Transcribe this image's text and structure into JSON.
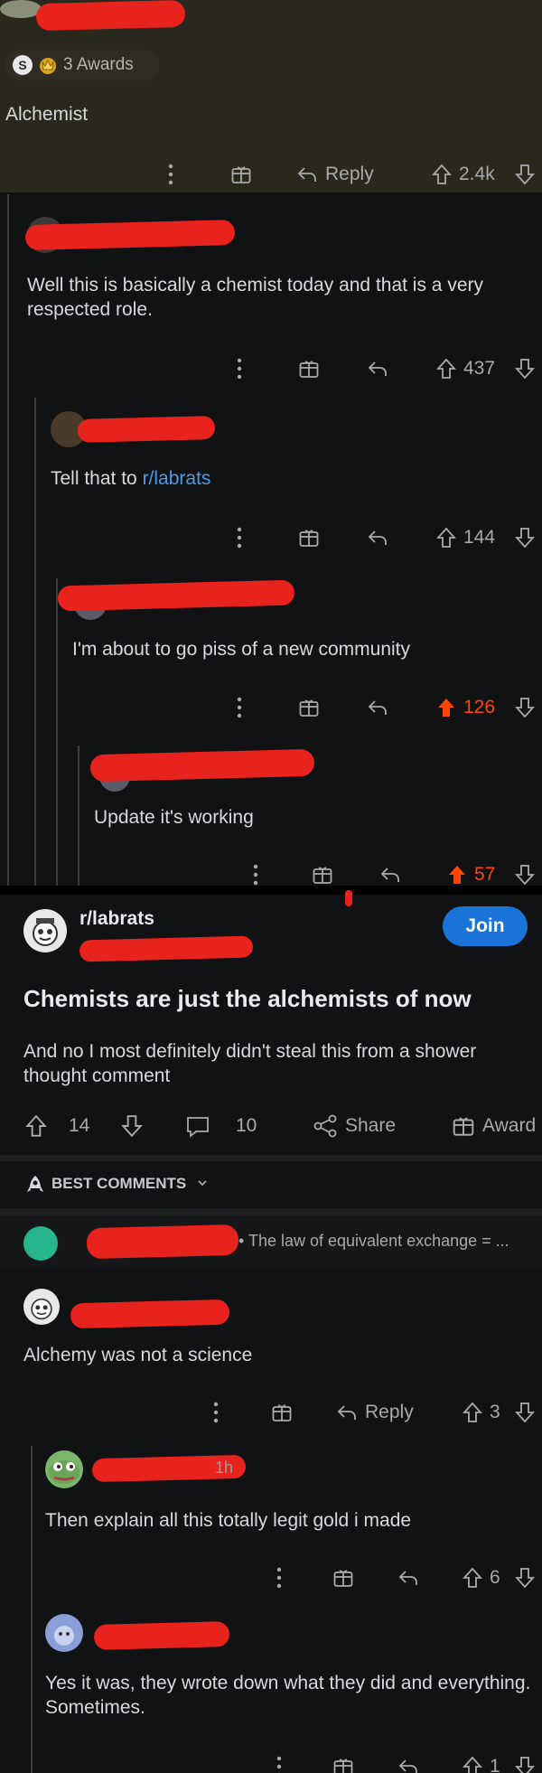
{
  "top_comment": {
    "awards_label": "3 Awards",
    "award_coin_letter": "S",
    "text": "Alchemist",
    "reply_label": "Reply",
    "score": "2.4k"
  },
  "comments": [
    {
      "text": "Well this is basically a chemist today and that is a very respected role.",
      "score": "437",
      "upvoted": false
    },
    {
      "text_prefix": "Tell that to ",
      "text_link": "r/labrats",
      "score": "144",
      "upvoted": false
    },
    {
      "text": "I'm about to go piss of a new community",
      "score": "126",
      "upvoted": true
    },
    {
      "text": "Update it's working",
      "score": "57",
      "upvoted": true
    }
  ],
  "post": {
    "subreddit": "r/labrats",
    "join_label": "Join",
    "title": "Chemists are just the alchemists of now",
    "body": "And no I most definitely didn't steal this from a shower thought comment",
    "score": "14",
    "comments_count": "10",
    "share_label": "Share",
    "award_label": "Award",
    "sort_label": "BEST COMMENTS",
    "preview_text": "• The law of equivalent exchange = ..."
  },
  "post_comments": [
    {
      "text": "Alchemy was not a science",
      "reply_label": "Reply",
      "score": "3",
      "time": ""
    },
    {
      "text": "Then explain all this totally legit gold i made",
      "score": "6",
      "time": "1h"
    },
    {
      "text": "Yes it was, they wrote down what they did and everything. Sometimes.",
      "score": "1",
      "time": ""
    }
  ],
  "colors": {
    "accent_orange": "#ff4500",
    "link_blue": "#4b9ce8",
    "join_blue": "#1a73d9",
    "redaction_red": "#e8231d"
  }
}
